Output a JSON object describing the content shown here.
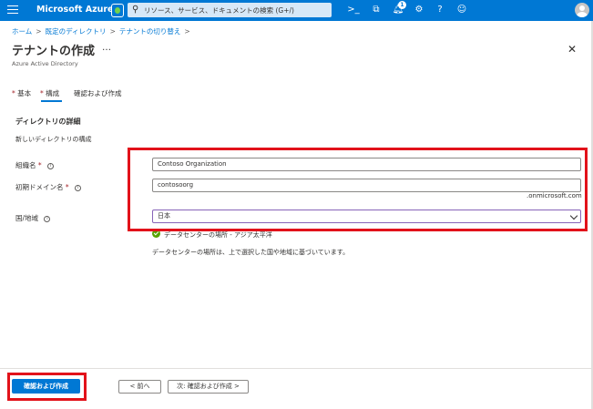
{
  "topbar": {
    "brand": "Microsoft Azure",
    "search_placeholder": "リソース、サービス、ドキュメントの検索 (G+/)",
    "notification_count": "1",
    "icons": [
      "menu-icon",
      "copilot-icon",
      "search-icon",
      "cloud-shell-icon",
      "directory-filter-icon",
      "notifications-icon",
      "settings-icon",
      "help-icon",
      "feedback-icon",
      "avatar"
    ]
  },
  "breadcrumb": {
    "items": [
      "ホーム",
      "既定のディレクトリ",
      "テナントの切り替え"
    ],
    "separator": ">"
  },
  "header": {
    "title": "テナントの作成",
    "more": "…",
    "subtitle": "Azure Active Directory",
    "close": "✕"
  },
  "tabs": [
    {
      "label": "基本",
      "required": true
    },
    {
      "label": "構成",
      "required": true,
      "active": true
    },
    {
      "label": "確認および作成",
      "required": false
    }
  ],
  "section": {
    "title": "ディレクトリの詳細",
    "description": "新しいディレクトリの構成"
  },
  "form": {
    "org_name": {
      "label": "組織名",
      "required_mark": "*",
      "value": "Contoso Organization"
    },
    "initial_domain": {
      "label": "初期ドメイン名",
      "required_mark": "*",
      "value": "contosoorg",
      "suffix": ".onmicrosoft.com"
    },
    "country": {
      "label": "国/地域",
      "value": "日本"
    },
    "datacenter_location": "データセンターの場所 - アジア太平洋",
    "datacenter_note": "データセンターの場所は、上で選択した国や地域に基づいています。"
  },
  "footer": {
    "review_create": "確認および作成",
    "previous": "< 前へ",
    "next": "次: 確認および作成 >"
  },
  "colors": {
    "brand_blue": "#0078d4",
    "highlight_red": "#e2121a",
    "success_green": "#57a300",
    "select_border": "#8764b8"
  }
}
